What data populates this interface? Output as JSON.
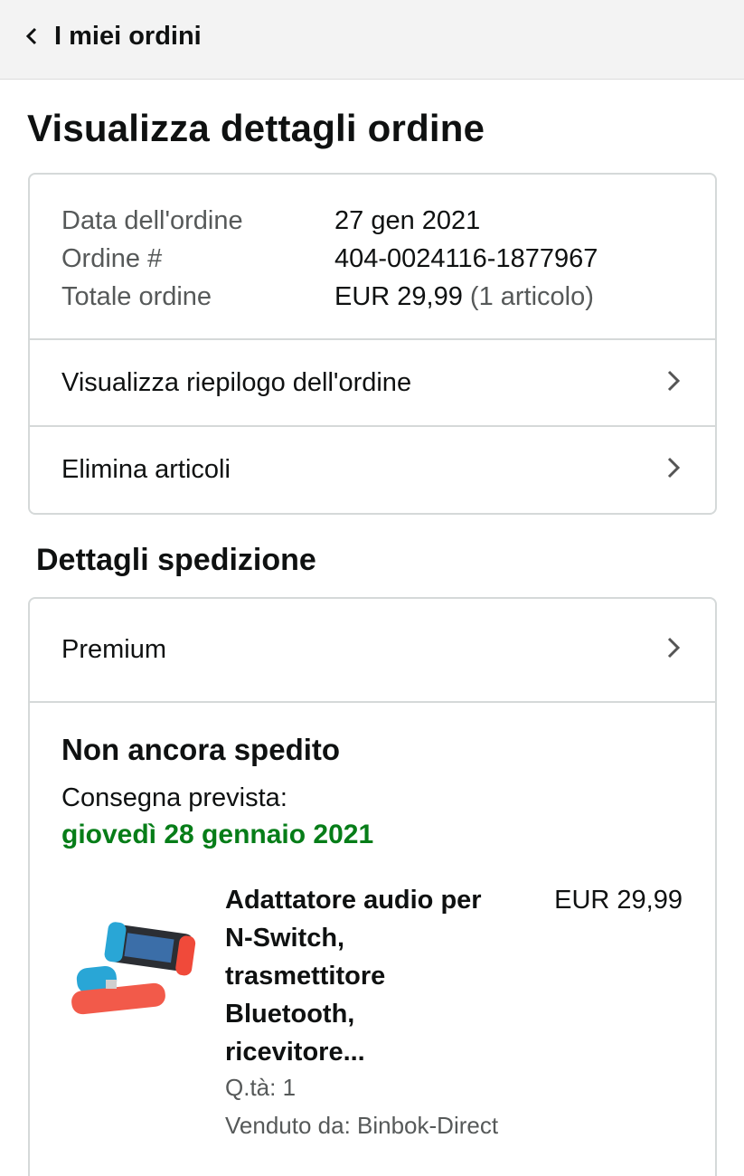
{
  "header": {
    "back_label": "I miei ordini"
  },
  "page": {
    "title": "Visualizza dettagli ordine"
  },
  "order": {
    "date_label": "Data dell'ordine",
    "date_value": "27 gen 2021",
    "number_label": "Ordine #",
    "number_value": "404-0024116-1877967",
    "total_label": "Totale ordine",
    "total_value": "EUR 29,99",
    "total_items": "(1 articolo)",
    "summary_link": "Visualizza riepilogo dell'ordine",
    "delete_link": "Elimina articoli"
  },
  "shipping": {
    "section_title": "Dettagli spedizione",
    "service": "Premium",
    "status": "Non ancora spedito",
    "delivery_label": "Consegna prevista:",
    "delivery_date": "giovedì 28 gennaio 2021",
    "delivery_color": "#067d18"
  },
  "product": {
    "title_lines": [
      "Adattatore audio per",
      "N-Switch,",
      "trasmettitore",
      "Bluetooth,",
      "ricevitore..."
    ],
    "price": "EUR 29,99",
    "quantity": "Q.tà: 1",
    "seller": "Venduto da: Binbok-Direct"
  },
  "icons": {
    "back": "chevron-left-icon",
    "row_arrow": "chevron-right-icon"
  }
}
